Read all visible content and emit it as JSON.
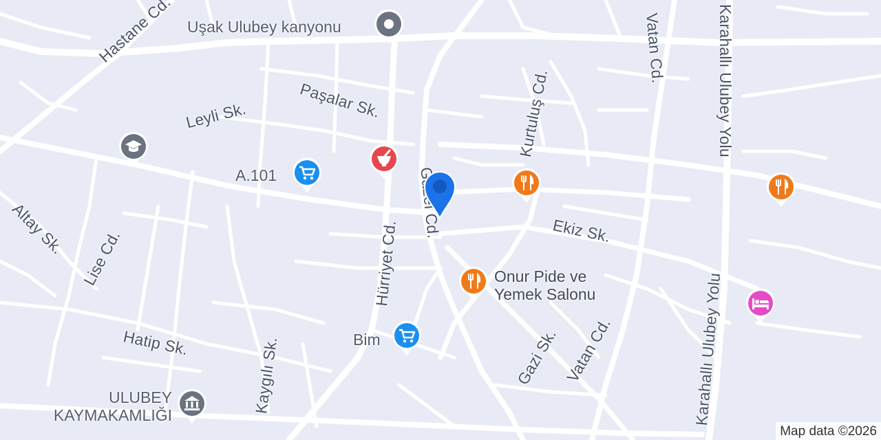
{
  "map": {
    "streets": {
      "hastane": "Hastane Cd.",
      "leyli": "Leyli Sk.",
      "pasalar": "Paşalar Sk.",
      "altay": "Altay Sk.",
      "lise": "Lise Cd.",
      "hurriyet": "Hürriyet Cd.",
      "cumhuriyet": "Gazel Cd.",
      "kurtulus": "Kurtuluş Cd.",
      "vatan_top": "Vatan Cd.",
      "vatan_bottom": "Vatan Cd.",
      "karahalli_top": "Karahallı Ulubey Yolu",
      "karahalli_bottom": "Karahallı Ulubey Yolu",
      "ekiz": "Ekiz Sk.",
      "gazi": "Gazi Sk.",
      "hatip": "Hatip Sk.",
      "kaygili": "Kaygılı Sk."
    },
    "pois": {
      "kanyon": {
        "name": "Uşak Ulubey kanyonu",
        "icon": "location-pin-icon",
        "color": "#6b7280"
      },
      "school": {
        "name": "",
        "icon": "graduation-cap-icon",
        "color": "#6b7280"
      },
      "a101": {
        "name": "A.101",
        "icon": "shopping-cart-icon",
        "color": "#1a8ff0"
      },
      "pharmacy": {
        "name": "",
        "icon": "mortar-pestle-icon",
        "color": "#e8464f"
      },
      "restaurant1": {
        "name": "",
        "icon": "fork-knife-icon",
        "color": "#f07a1a"
      },
      "restaurant2": {
        "name": "",
        "icon": "fork-knife-icon",
        "color": "#f07a1a"
      },
      "onur": {
        "name_line1": "Onur Pide ve",
        "name_line2": "Yemek Salonu",
        "icon": "fork-knife-icon",
        "color": "#f07a1a"
      },
      "hotel": {
        "name": "",
        "icon": "bed-icon",
        "color": "#e64bc7"
      },
      "bim": {
        "name": "Bim",
        "icon": "shopping-cart-icon",
        "color": "#1a8ff0"
      },
      "kaymakamlik": {
        "name_line1": "ULUBEY",
        "name_line2": "KAYMAKAMLIĞI",
        "icon": "government-building-icon",
        "color": "#6b7280"
      }
    },
    "marker": {
      "icon": "location-marker-icon",
      "color": "#1a73e8"
    },
    "attribution": "Map data ©2026"
  }
}
